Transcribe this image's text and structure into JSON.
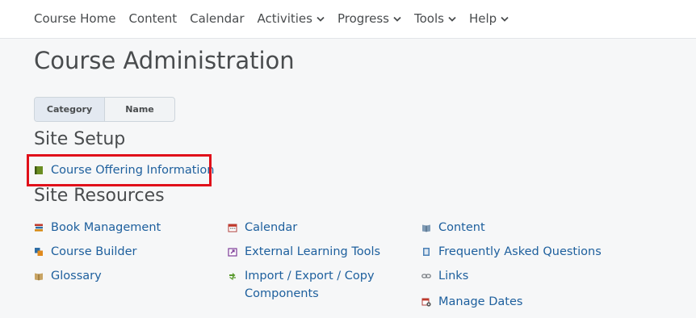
{
  "nav": {
    "items": [
      {
        "label": "Course Home",
        "dropdown": false
      },
      {
        "label": "Content",
        "dropdown": false
      },
      {
        "label": "Calendar",
        "dropdown": false
      },
      {
        "label": "Activities",
        "dropdown": true
      },
      {
        "label": "Progress",
        "dropdown": true
      },
      {
        "label": "Tools",
        "dropdown": true
      },
      {
        "label": "Help",
        "dropdown": true
      }
    ]
  },
  "page": {
    "title": "Course Administration"
  },
  "view_toggle": {
    "category_label": "Category",
    "name_label": "Name",
    "selected": "Category"
  },
  "sections": {
    "site_setup": {
      "title": "Site Setup",
      "items": [
        {
          "label": "Course Offering Information",
          "icon": "book-green-icon"
        }
      ]
    },
    "site_resources": {
      "title": "Site Resources",
      "columns": [
        [
          {
            "label": "Book Management",
            "icon": "books-stack-icon"
          },
          {
            "label": "Course Builder",
            "icon": "course-builder-icon"
          },
          {
            "label": "Glossary",
            "icon": "glossary-icon"
          }
        ],
        [
          {
            "label": "Calendar",
            "icon": "calendar-icon"
          },
          {
            "label": "External Learning Tools",
            "icon": "external-tools-icon"
          },
          {
            "label": "Import / Export / Copy Components",
            "icon": "import-export-icon"
          }
        ],
        [
          {
            "label": "Content",
            "icon": "content-book-icon"
          },
          {
            "label": "Frequently Asked Questions",
            "icon": "faq-icon"
          },
          {
            "label": "Links",
            "icon": "link-icon"
          },
          {
            "label": "Manage Dates",
            "icon": "manage-dates-icon"
          }
        ]
      ]
    }
  },
  "colors": {
    "link": "#1d5f9d",
    "text": "#494c4e",
    "highlight": "#e0101a",
    "page_bg": "#f6f7f8"
  }
}
